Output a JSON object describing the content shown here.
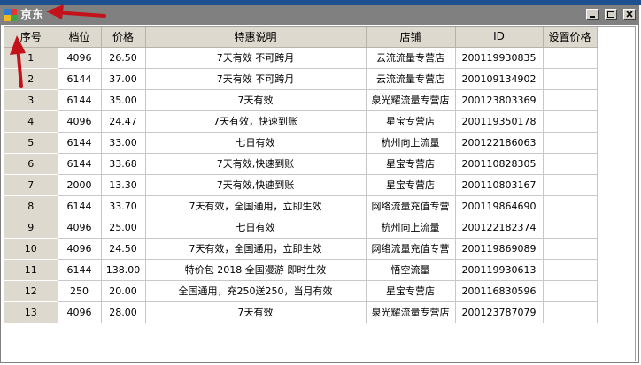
{
  "window": {
    "title": "京东",
    "controls": [
      "minimize",
      "maximize",
      "close"
    ]
  },
  "table": {
    "headers": [
      "序号",
      "档位",
      "价格",
      "特惠说明",
      "店铺",
      "ID",
      "设置价格"
    ],
    "rows": [
      [
        "1",
        "4096",
        "26.50",
        "7天有效 不可跨月",
        "云流流量专营店",
        "200119930835",
        ""
      ],
      [
        "2",
        "6144",
        "37.00",
        "7天有效 不可跨月",
        "云流流量专营店",
        "200109134902",
        ""
      ],
      [
        "3",
        "6144",
        "35.00",
        "7天有效",
        "泉光耀流量专营店",
        "200123803369",
        ""
      ],
      [
        "4",
        "4096",
        "24.47",
        "7天有效，快速到账",
        "星宝专营店",
        "200119350178",
        ""
      ],
      [
        "5",
        "6144",
        "33.00",
        "七日有效",
        "杭州向上流量",
        "200122186063",
        ""
      ],
      [
        "6",
        "6144",
        "33.68",
        "7天有效,快速到账",
        "星宝专营店",
        "200110828305",
        ""
      ],
      [
        "7",
        "2000",
        "13.30",
        "7天有效,快速到账",
        "星宝专营店",
        "200110803167",
        ""
      ],
      [
        "8",
        "6144",
        "33.70",
        "7天有效，全国通用，立即生效",
        "网络流量充值专营",
        "200119864690",
        ""
      ],
      [
        "9",
        "4096",
        "25.00",
        "七日有效",
        "杭州向上流量",
        "200122182374",
        ""
      ],
      [
        "10",
        "4096",
        "24.50",
        "7天有效，全国通用，立即生效",
        "网络流量充值专营",
        "200119869089",
        ""
      ],
      [
        "11",
        "6144",
        "138.00",
        "特价包 2018 全国漫游 即时生效",
        "悟空流量",
        "200119930613",
        ""
      ],
      [
        "12",
        "250",
        "20.00",
        "全国通用，充250送250，当月有效",
        "星宝专营店",
        "200116830596",
        ""
      ],
      [
        "13",
        "4096",
        "28.00",
        "7天有效",
        "泉光耀流量专营店",
        "200123787079",
        ""
      ]
    ]
  },
  "colors": {
    "titlebar": "#808080",
    "header_bg": "#ded9ce",
    "annotation_arrow": "#c4121a"
  }
}
